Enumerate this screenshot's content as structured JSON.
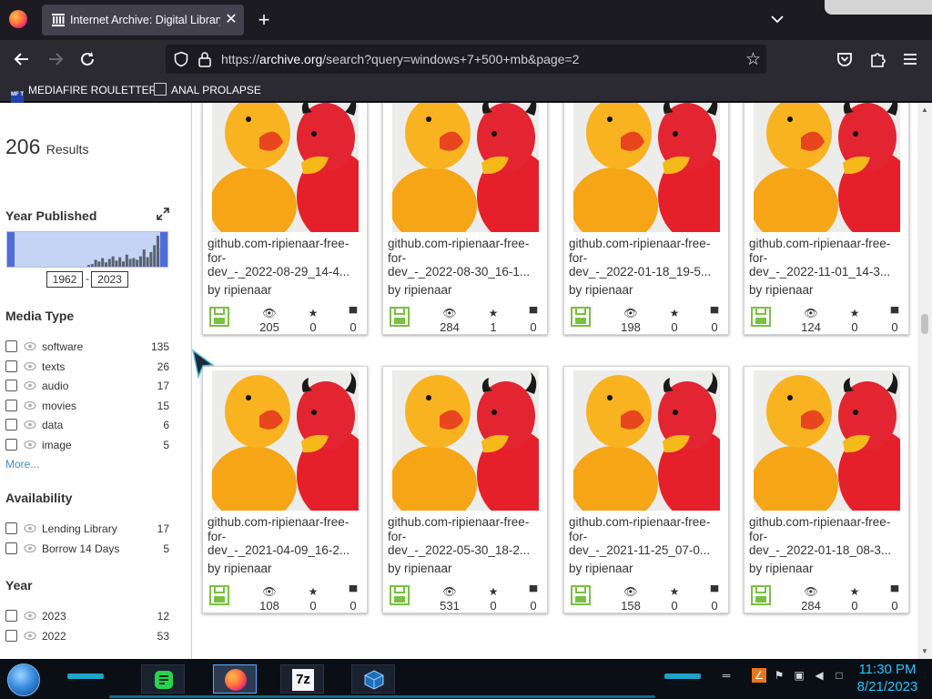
{
  "browser": {
    "tab_title": "Internet Archive: Digital Library",
    "tab_close_glyph": "✕",
    "new_tab_glyph": "+",
    "url_prefix": "https://",
    "url_domain": "archive.org",
    "url_path": "/search?query=windows+7+500+mb&page=2"
  },
  "bookmarks": [
    {
      "label": "MEDIAFIRE ROULETTER",
      "icon_text": "MF T"
    },
    {
      "label": "ANAL PROLAPSE",
      "icon_text": ""
    }
  ],
  "sidebar": {
    "results_count": "206",
    "results_label": "Results",
    "year_published_heading": "Year Published",
    "year_from": "1962",
    "year_to": "2023",
    "year_sep": "-",
    "histogram_bars": [
      2,
      3,
      8,
      6,
      10,
      5,
      9,
      12,
      7,
      11,
      6,
      14,
      9,
      10,
      8,
      12,
      20,
      11,
      17,
      25,
      36,
      22,
      30
    ],
    "media_type_heading": "Media Type",
    "media_types": [
      {
        "label": "software",
        "count": "135"
      },
      {
        "label": "texts",
        "count": "26"
      },
      {
        "label": "audio",
        "count": "17"
      },
      {
        "label": "movies",
        "count": "15"
      },
      {
        "label": "data",
        "count": "6"
      },
      {
        "label": "image",
        "count": "5"
      }
    ],
    "more_label": "More...",
    "availability_heading": "Availability",
    "availability": [
      {
        "label": "Lending Library",
        "count": "17"
      },
      {
        "label": "Borrow 14 Days",
        "count": "5"
      }
    ],
    "year_heading": "Year",
    "years": [
      {
        "label": "2023",
        "count": "12"
      },
      {
        "label": "2022",
        "count": "53"
      }
    ]
  },
  "results": [
    {
      "title1": "github.com-ripienaar-free-",
      "title2": "for-",
      "title3": "dev_-_2022-08-29_14-4...",
      "by": "by ripienaar",
      "views": "205",
      "favs": "0",
      "reviews": "0"
    },
    {
      "title1": "github.com-ripienaar-free-",
      "title2": "for-",
      "title3": "dev_-_2022-08-30_16-1...",
      "by": "by ripienaar",
      "views": "284",
      "favs": "1",
      "reviews": "0"
    },
    {
      "title1": "github.com-ripienaar-free-",
      "title2": "for-",
      "title3": "dev_-_2022-01-18_19-5...",
      "by": "by ripienaar",
      "views": "198",
      "favs": "0",
      "reviews": "0"
    },
    {
      "title1": "github.com-ripienaar-free-",
      "title2": "for-",
      "title3": "dev_-_2022-11-01_14-3...",
      "by": "by ripienaar",
      "views": "124",
      "favs": "0",
      "reviews": "0"
    },
    {
      "title1": "github.com-ripienaar-free-",
      "title2": "for-",
      "title3": "dev_-_2021-04-09_16-2...",
      "by": "by ripienaar",
      "views": "108",
      "favs": "0",
      "reviews": "0"
    },
    {
      "title1": "github.com-ripienaar-free-",
      "title2": "for-",
      "title3": "dev_-_2022-05-30_18-2...",
      "by": "by ripienaar",
      "views": "531",
      "favs": "0",
      "reviews": "0"
    },
    {
      "title1": "github.com-ripienaar-free-",
      "title2": "for-",
      "title3": "dev_-_2021-11-25_07-0...",
      "by": "by ripienaar",
      "views": "158",
      "favs": "0",
      "reviews": "0"
    },
    {
      "title1": "github.com-ripienaar-free-",
      "title2": "for-",
      "title3": "dev_-_2022-01-18_08-3...",
      "by": "by ripienaar",
      "views": "284",
      "favs": "0",
      "reviews": "0"
    }
  ],
  "taskbar": {
    "apps": [
      "notes-app",
      "firefox",
      "7zip",
      "virtualbox"
    ],
    "sevenzip_label": "7z",
    "time": "11:30 PM",
    "date": "8/21/2023"
  },
  "colors": {
    "accent_blue": "#4f6bd9",
    "link_blue": "#428bca",
    "format_green": "#7ac142",
    "clock_cyan": "#1ec8ff"
  }
}
